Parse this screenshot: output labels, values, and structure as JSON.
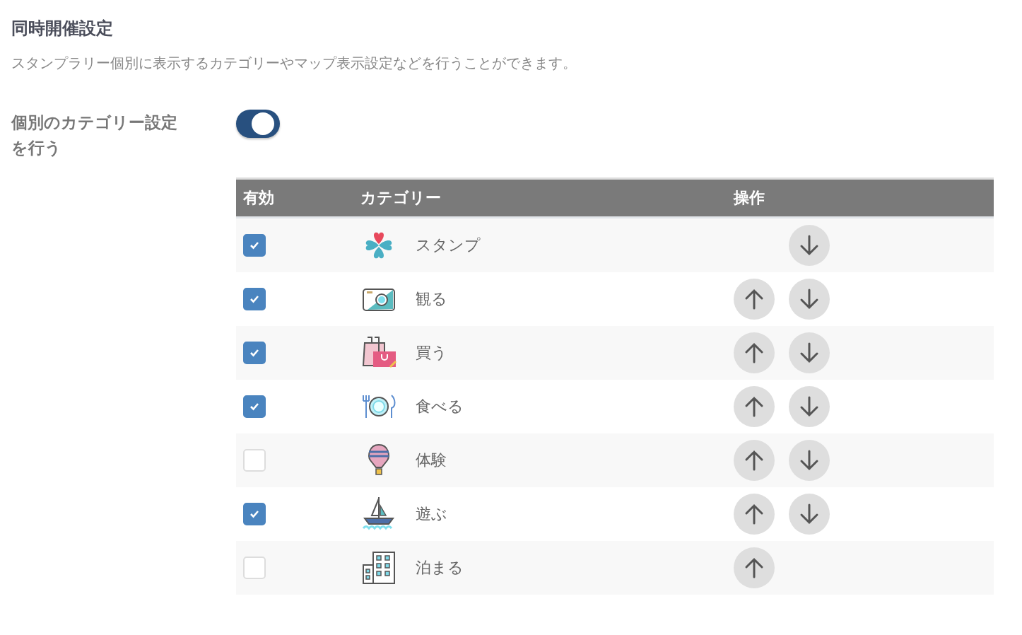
{
  "section": {
    "title": "同時開催設定",
    "description": "スタンプラリー個別に表示するカテゴリーやマップ表示設定などを行うことができます。"
  },
  "setting": {
    "label": "個別のカテゴリー設定を行う",
    "on": true
  },
  "table": {
    "columns": [
      "有効",
      "カテゴリー",
      "操作"
    ],
    "rows": [
      {
        "enabled": true,
        "name": "スタンプ",
        "can_move_up": false,
        "can_move_down": true
      },
      {
        "enabled": true,
        "name": "観る",
        "can_move_up": true,
        "can_move_down": true
      },
      {
        "enabled": true,
        "name": "買う",
        "can_move_up": true,
        "can_move_down": true
      },
      {
        "enabled": true,
        "name": "食べる",
        "can_move_up": true,
        "can_move_down": true
      },
      {
        "enabled": false,
        "name": "体験",
        "can_move_up": true,
        "can_move_down": true
      },
      {
        "enabled": true,
        "name": "遊ぶ",
        "can_move_up": true,
        "can_move_down": true
      },
      {
        "enabled": false,
        "name": "泊まる",
        "can_move_up": true,
        "can_move_down": false
      }
    ]
  }
}
